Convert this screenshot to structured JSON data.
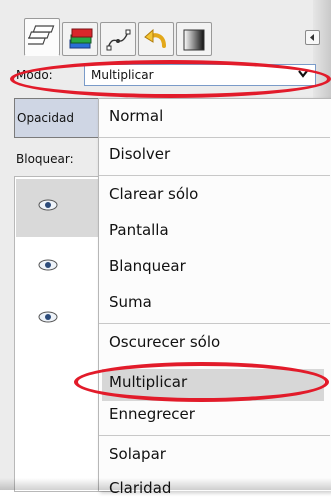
{
  "colors": {
    "annotation": "#e21b2a",
    "menu_bg": "#fcfcfc",
    "highlight": "#d7d7d7",
    "select_border": "#7a9bc9",
    "opacity_bg": "#cfd6e4"
  },
  "tabs": [
    {
      "icon": "layers-icon"
    },
    {
      "icon": "channels-icon"
    },
    {
      "icon": "paths-icon"
    },
    {
      "icon": "undo-history-icon"
    },
    {
      "icon": "gradient-icon"
    }
  ],
  "panel_menu_icon": "panel-menu-icon",
  "mode": {
    "label": "Modo:",
    "value": "Multiplicar"
  },
  "opacity": {
    "label": "Opacidad"
  },
  "lock": {
    "label": "Bloquear:"
  },
  "layers": [
    {
      "visible_icon": "eye-icon",
      "selected": true
    },
    {
      "visible_icon": "eye-icon",
      "selected": false
    },
    {
      "visible_icon": "eye-icon",
      "selected": false
    }
  ],
  "menu": {
    "items": [
      {
        "label": "Normal"
      },
      {
        "label": "Disolver"
      },
      {
        "label": "Clarear sólo"
      },
      {
        "label": "Pantalla"
      },
      {
        "label": "Blanquear"
      },
      {
        "label": "Suma"
      },
      {
        "label": "Oscurecer sólo"
      },
      {
        "label": "Multiplicar",
        "highlighted": true
      },
      {
        "label": "Ennegrecer"
      },
      {
        "label": "Solapar"
      },
      {
        "label": "Claridad"
      }
    ]
  }
}
